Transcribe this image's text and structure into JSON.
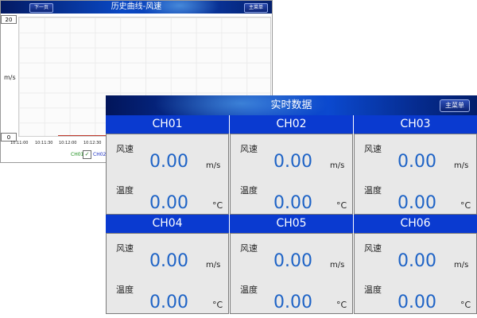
{
  "history": {
    "title": "历史曲线-风速",
    "next_button": "下一页",
    "main_menu_button": "主菜单",
    "y_max": "20",
    "y_min": "0",
    "y_unit": "m/s",
    "x_ticks": [
      "10:11:00",
      "10:11:30",
      "10:12:00",
      "10:12:30"
    ],
    "legend": [
      {
        "name": "CH01",
        "color": "#1a8f1a",
        "checked": true
      },
      {
        "name": "CH02",
        "color": "#1b2fc4"
      }
    ]
  },
  "realtime": {
    "title": "实时数据",
    "main_menu_button": "主菜单",
    "wind_label": "风速",
    "temp_label": "温度",
    "wind_unit": "m/s",
    "temp_unit": "°C",
    "channels": [
      {
        "name": "CH01",
        "wind": "0.00",
        "temp": "0.00"
      },
      {
        "name": "CH02",
        "wind": "0.00",
        "temp": "0.00"
      },
      {
        "name": "CH03",
        "wind": "0.00",
        "temp": "0.00"
      },
      {
        "name": "CH04",
        "wind": "0.00",
        "temp": "0.00"
      },
      {
        "name": "CH05",
        "wind": "0.00",
        "temp": "0.00"
      },
      {
        "name": "CH06",
        "wind": "0.00",
        "temp": "0.00"
      }
    ]
  },
  "colors": {
    "header_blue": "#0a3ad0",
    "value_blue": "#1e63c6",
    "cell_gray": "#e8e8e8"
  },
  "icons": {
    "legend_check": "checkmark-icon"
  }
}
